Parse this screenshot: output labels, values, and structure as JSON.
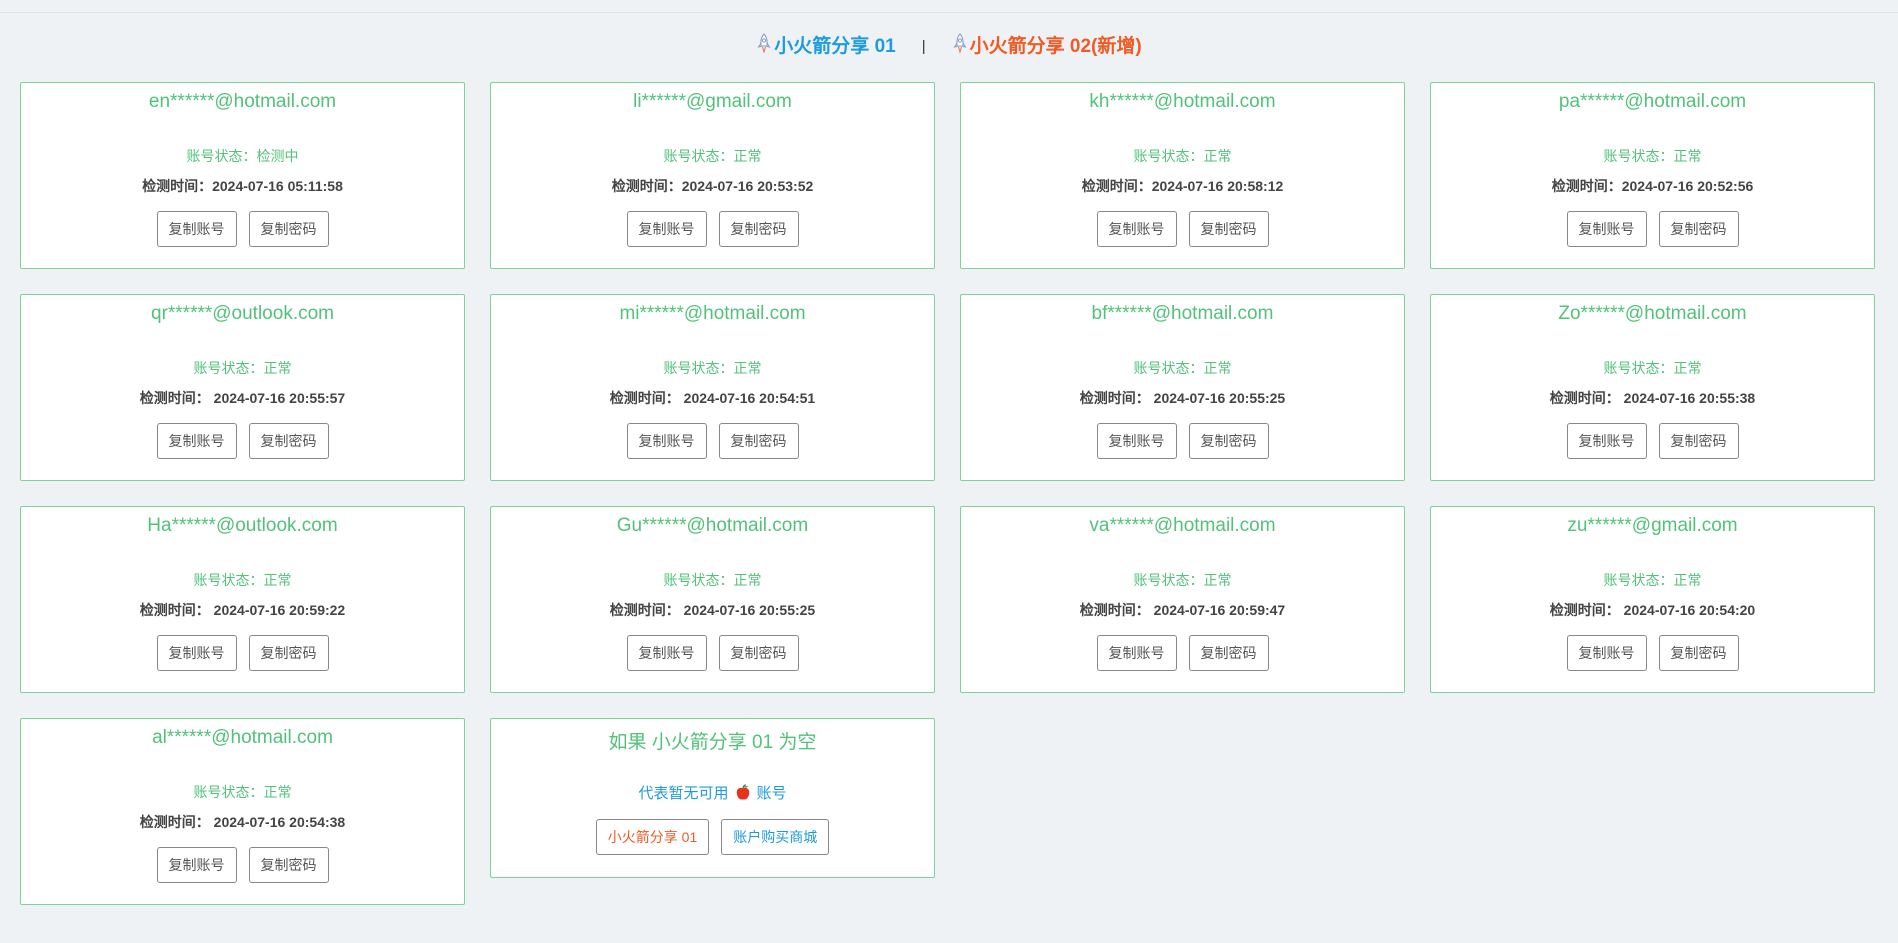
{
  "header": {
    "link1": "小火箭分享 01",
    "separator": "|",
    "link2": "小火箭分享 02(新增)"
  },
  "labels": {
    "status_prefix": "账号状态：",
    "time_prefix": "检测时间：",
    "copy_account": "复制账号",
    "copy_password": "复制密码"
  },
  "accounts": [
    {
      "email": "en******@hotmail.com",
      "status": "检测中",
      "time": "2024-07-16 05:11:58"
    },
    {
      "email": "li******@gmail.com",
      "status": "正常",
      "time": "2024-07-16 20:53:52"
    },
    {
      "email": "kh******@hotmail.com",
      "status": "正常",
      "time": "2024-07-16 20:58:12"
    },
    {
      "email": "pa******@hotmail.com",
      "status": "正常",
      "time": "2024-07-16 20:52:56"
    },
    {
      "email": "qr******@outlook.com",
      "status": "正常",
      "time": " 2024-07-16 20:55:57"
    },
    {
      "email": "mi******@hotmail.com",
      "status": "正常",
      "time": " 2024-07-16 20:54:51"
    },
    {
      "email": "bf******@hotmail.com",
      "status": "正常",
      "time": " 2024-07-16 20:55:25"
    },
    {
      "email": "Zo******@hotmail.com",
      "status": "正常",
      "time": " 2024-07-16 20:55:38"
    },
    {
      "email": "Ha******@outlook.com",
      "status": "正常",
      "time": " 2024-07-16 20:59:22"
    },
    {
      "email": "Gu******@hotmail.com",
      "status": "正常",
      "time": " 2024-07-16 20:55:25"
    },
    {
      "email": "va******@hotmail.com",
      "status": "正常",
      "time": " 2024-07-16 20:59:47"
    },
    {
      "email": "zu******@gmail.com",
      "status": "正常",
      "time": " 2024-07-16 20:54:20"
    },
    {
      "email": "al******@hotmail.com",
      "status": "正常",
      "time": " 2024-07-16 20:54:38"
    }
  ],
  "info_card": {
    "title": "如果 小火箭分享 01 为空",
    "note_before": "代表暂无可用",
    "note_icon": "apple-icon",
    "note_after": "账号",
    "button1": "小火箭分享 01",
    "button2": "账户购买商城"
  },
  "colors": {
    "background": "#eef2f5",
    "card_border": "#7fd39a",
    "green_text": "#52c27a",
    "blue": "#1e9bdc",
    "orange": "#f15a24"
  }
}
